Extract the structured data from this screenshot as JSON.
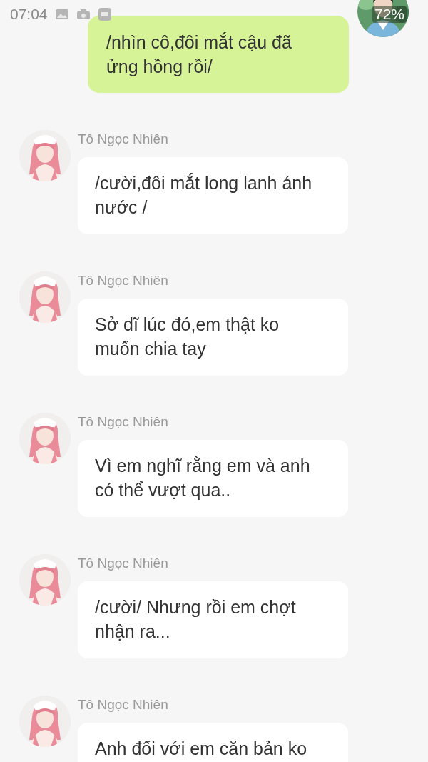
{
  "status_bar": {
    "time": "07:04",
    "battery": "72%"
  },
  "messages": [
    {
      "kind": "sent",
      "text": "/nhìn cô,đôi mắt cậu đã ửng hồng rồi/"
    },
    {
      "kind": "received",
      "sender": "Tô Ngọc Nhiên",
      "text": "/cười,đôi mắt long lanh ánh nước /"
    },
    {
      "kind": "received",
      "sender": "Tô Ngọc Nhiên",
      "text": "Sở dĩ lúc đó,em thật ko muốn chia tay"
    },
    {
      "kind": "received",
      "sender": "Tô Ngọc Nhiên",
      "text": "Vì em nghĩ rằng em và anh có thể vượt qua.."
    },
    {
      "kind": "received",
      "sender": "Tô Ngọc Nhiên",
      "text": "/cười/ Nhưng rồi em chợt nhận ra..."
    },
    {
      "kind": "received",
      "sender": "Tô Ngọc Nhiên",
      "text": "Anh đối với em căn bản ko"
    }
  ]
}
